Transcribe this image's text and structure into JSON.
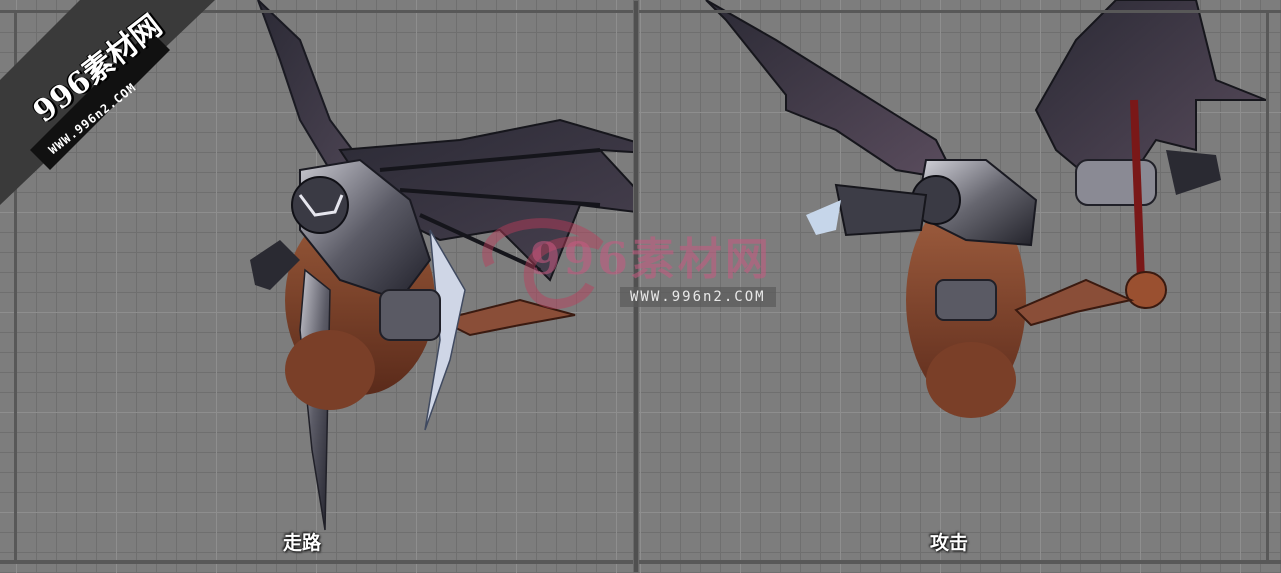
{
  "watermark": {
    "corner_text": "996素材网",
    "corner_url": "WWW.996n2.COM",
    "center_text": "996素材网",
    "center_url": "WWW.996n2.COM"
  },
  "panels": [
    {
      "label": "走路",
      "creature": "winged-demon-walk-pose"
    },
    {
      "label": "攻击",
      "creature": "winged-demon-attack-pose"
    }
  ],
  "colors": {
    "grid_bg": "#7d7d7d",
    "grid_line": "#6f6f6f",
    "frame": "#505050",
    "label": "#ffffff"
  }
}
